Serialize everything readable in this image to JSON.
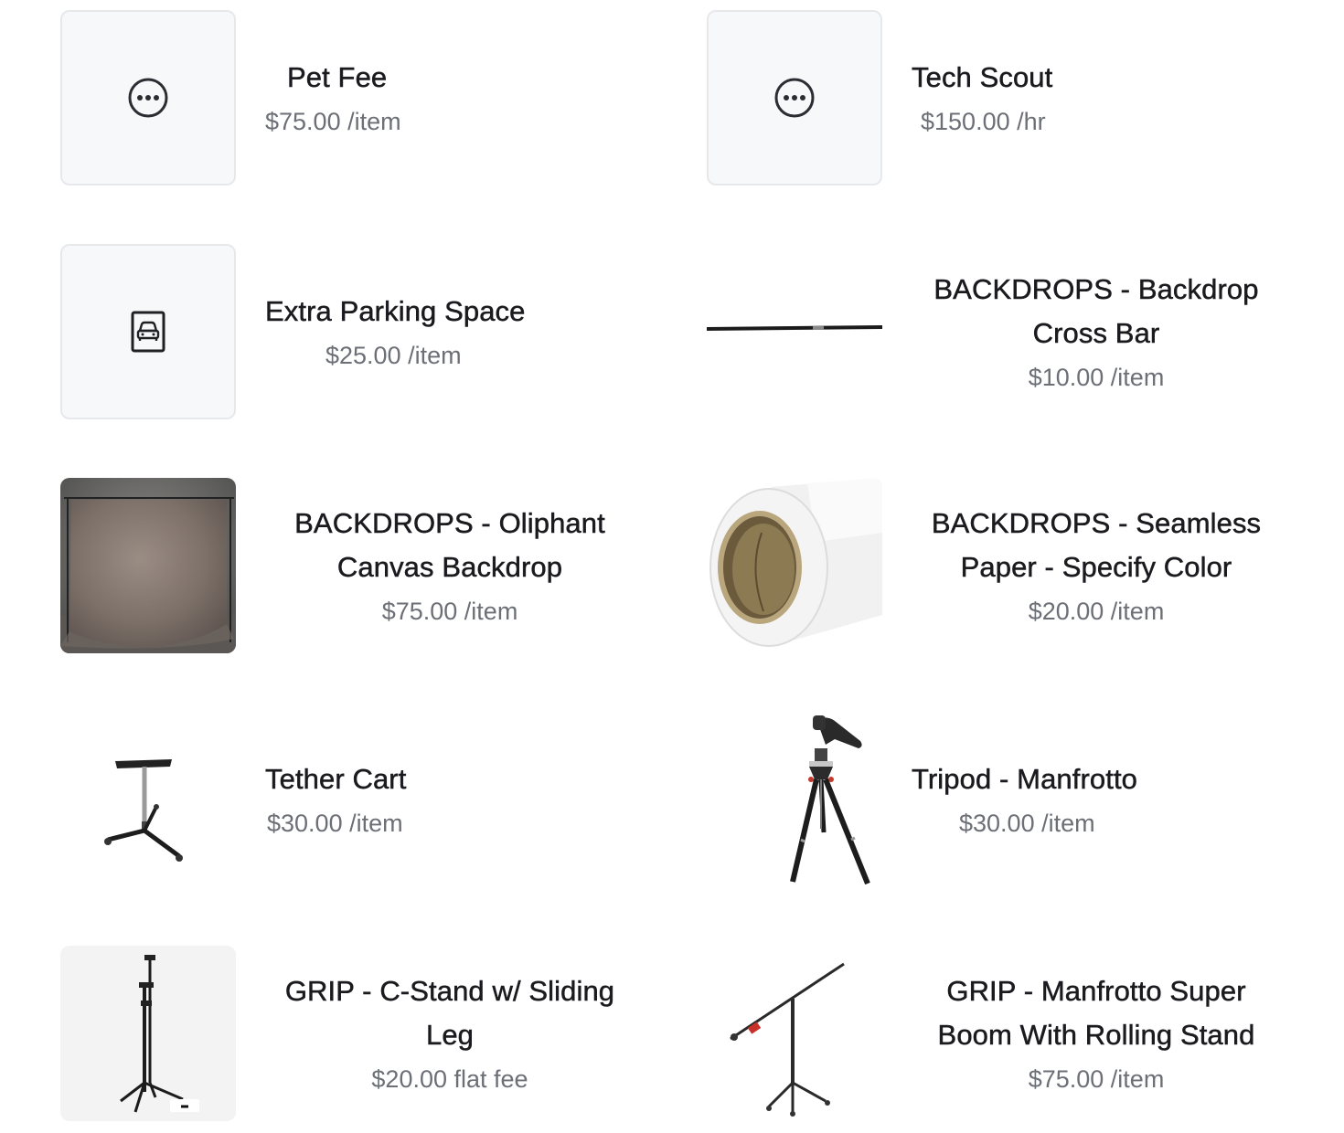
{
  "items": [
    {
      "title": "Pet Fee",
      "price": "$75.00",
      "unit": "/item",
      "thumb": "more-icon"
    },
    {
      "title": "Tech Scout",
      "price": "$150.00",
      "unit": "/hr",
      "thumb": "more-icon"
    },
    {
      "title": "Extra Parking Space",
      "price": "$25.00",
      "unit": "/item",
      "thumb": "parking-car-icon"
    },
    {
      "title": "BACKDROPS - Backdrop Cross Bar",
      "price": "$10.00",
      "unit": "/item",
      "thumb": "cross-bar-image"
    },
    {
      "title": "BACKDROPS - Oliphant Canvas Backdrop",
      "price": "$75.00",
      "unit": "/item",
      "thumb": "canvas-backdrop-image"
    },
    {
      "title": "BACKDROPS - Seamless Paper - Specify Color",
      "price": "$20.00",
      "unit": "/item",
      "thumb": "paper-roll-image"
    },
    {
      "title": "Tether Cart",
      "price": "$30.00",
      "unit": "/item",
      "thumb": "tether-cart-image"
    },
    {
      "title": "Tripod - Manfrotto",
      "price": "$30.00",
      "unit": "/item",
      "thumb": "tripod-image"
    },
    {
      "title": "GRIP - C-Stand w/ Sliding Leg",
      "price": "$20.00",
      "unit": "flat fee",
      "thumb": "c-stand-image"
    },
    {
      "title": "GRIP - Manfrotto Super Boom With Rolling Stand",
      "price": "$75.00",
      "unit": "/item",
      "thumb": "boom-stand-image"
    }
  ],
  "colors": {
    "title": "#1a1a1f",
    "price": "#6c6f76",
    "placeholder_bg": "#f7f8fa",
    "placeholder_border": "#e6e8ec"
  }
}
